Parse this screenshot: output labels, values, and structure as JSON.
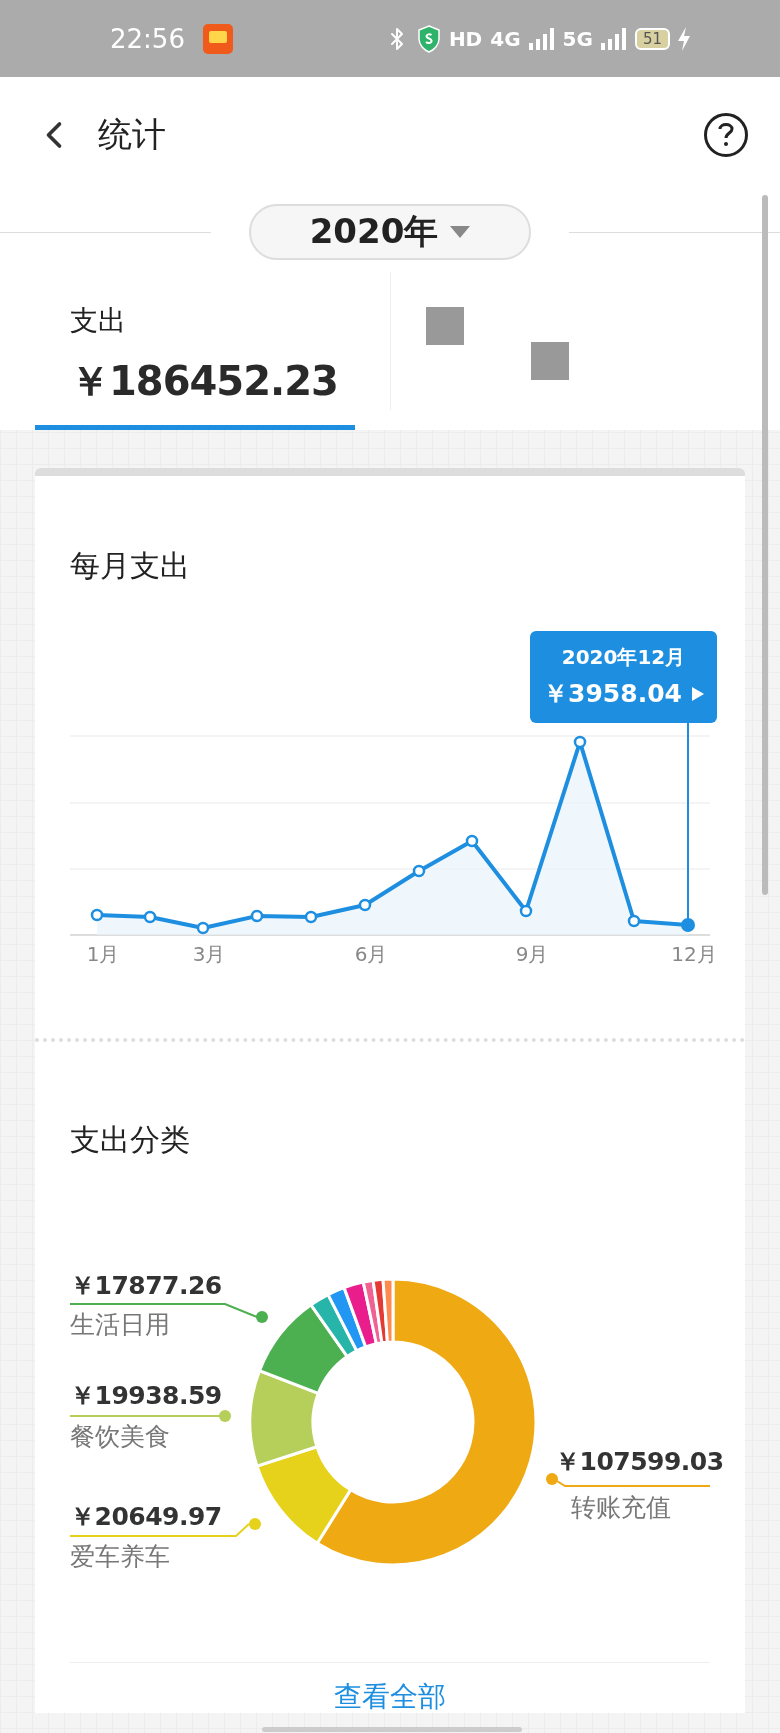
{
  "status_bar": {
    "time": "22:56",
    "hd": "HD",
    "networks": [
      "4G",
      "5G"
    ],
    "battery": "51"
  },
  "header": {
    "title": "统计"
  },
  "year_picker": {
    "value": "2020年"
  },
  "tabs": [
    {
      "label": "支出",
      "amount": "￥186452.23",
      "selected": true
    }
  ],
  "monthly_card": {
    "title": "每月支出",
    "x_labels": [
      "1月",
      "3月",
      "6月",
      "9月",
      "12月"
    ],
    "tooltip": {
      "month": "2020年12月",
      "amount": "￥3958.04"
    }
  },
  "category_card": {
    "title": "支出分类",
    "categories": [
      {
        "amount": "￥17877.26",
        "name": "生活日用",
        "color": "#4caf50"
      },
      {
        "amount": "￥19938.59",
        "name": "餐饮美食",
        "color": "#b5cf5a"
      },
      {
        "amount": "￥20649.97",
        "name": "爱车养车",
        "color": "#e6d21b"
      },
      {
        "amount": "￥107599.03",
        "name": "转账充值",
        "color": "#eea913"
      }
    ],
    "view_all": "查看全部"
  }
}
